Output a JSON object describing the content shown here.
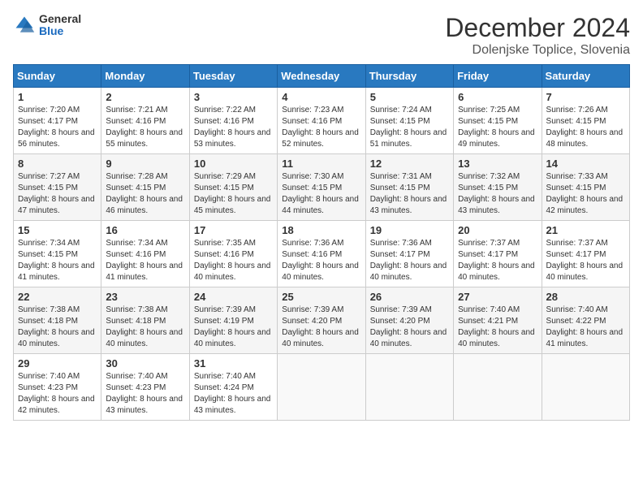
{
  "header": {
    "logo": {
      "general": "General",
      "blue": "Blue"
    },
    "title": "December 2024",
    "location": "Dolenjske Toplice, Slovenia"
  },
  "weekdays": [
    "Sunday",
    "Monday",
    "Tuesday",
    "Wednesday",
    "Thursday",
    "Friday",
    "Saturday"
  ],
  "weeks": [
    [
      {
        "day": "1",
        "sunrise": "7:20 AM",
        "sunset": "4:17 PM",
        "daylight": "8 hours and 56 minutes."
      },
      {
        "day": "2",
        "sunrise": "7:21 AM",
        "sunset": "4:16 PM",
        "daylight": "8 hours and 55 minutes."
      },
      {
        "day": "3",
        "sunrise": "7:22 AM",
        "sunset": "4:16 PM",
        "daylight": "8 hours and 53 minutes."
      },
      {
        "day": "4",
        "sunrise": "7:23 AM",
        "sunset": "4:16 PM",
        "daylight": "8 hours and 52 minutes."
      },
      {
        "day": "5",
        "sunrise": "7:24 AM",
        "sunset": "4:15 PM",
        "daylight": "8 hours and 51 minutes."
      },
      {
        "day": "6",
        "sunrise": "7:25 AM",
        "sunset": "4:15 PM",
        "daylight": "8 hours and 49 minutes."
      },
      {
        "day": "7",
        "sunrise": "7:26 AM",
        "sunset": "4:15 PM",
        "daylight": "8 hours and 48 minutes."
      }
    ],
    [
      {
        "day": "8",
        "sunrise": "7:27 AM",
        "sunset": "4:15 PM",
        "daylight": "8 hours and 47 minutes."
      },
      {
        "day": "9",
        "sunrise": "7:28 AM",
        "sunset": "4:15 PM",
        "daylight": "8 hours and 46 minutes."
      },
      {
        "day": "10",
        "sunrise": "7:29 AM",
        "sunset": "4:15 PM",
        "daylight": "8 hours and 45 minutes."
      },
      {
        "day": "11",
        "sunrise": "7:30 AM",
        "sunset": "4:15 PM",
        "daylight": "8 hours and 44 minutes."
      },
      {
        "day": "12",
        "sunrise": "7:31 AM",
        "sunset": "4:15 PM",
        "daylight": "8 hours and 43 minutes."
      },
      {
        "day": "13",
        "sunrise": "7:32 AM",
        "sunset": "4:15 PM",
        "daylight": "8 hours and 43 minutes."
      },
      {
        "day": "14",
        "sunrise": "7:33 AM",
        "sunset": "4:15 PM",
        "daylight": "8 hours and 42 minutes."
      }
    ],
    [
      {
        "day": "15",
        "sunrise": "7:34 AM",
        "sunset": "4:15 PM",
        "daylight": "8 hours and 41 minutes."
      },
      {
        "day": "16",
        "sunrise": "7:34 AM",
        "sunset": "4:16 PM",
        "daylight": "8 hours and 41 minutes."
      },
      {
        "day": "17",
        "sunrise": "7:35 AM",
        "sunset": "4:16 PM",
        "daylight": "8 hours and 40 minutes."
      },
      {
        "day": "18",
        "sunrise": "7:36 AM",
        "sunset": "4:16 PM",
        "daylight": "8 hours and 40 minutes."
      },
      {
        "day": "19",
        "sunrise": "7:36 AM",
        "sunset": "4:17 PM",
        "daylight": "8 hours and 40 minutes."
      },
      {
        "day": "20",
        "sunrise": "7:37 AM",
        "sunset": "4:17 PM",
        "daylight": "8 hours and 40 minutes."
      },
      {
        "day": "21",
        "sunrise": "7:37 AM",
        "sunset": "4:17 PM",
        "daylight": "8 hours and 40 minutes."
      }
    ],
    [
      {
        "day": "22",
        "sunrise": "7:38 AM",
        "sunset": "4:18 PM",
        "daylight": "8 hours and 40 minutes."
      },
      {
        "day": "23",
        "sunrise": "7:38 AM",
        "sunset": "4:18 PM",
        "daylight": "8 hours and 40 minutes."
      },
      {
        "day": "24",
        "sunrise": "7:39 AM",
        "sunset": "4:19 PM",
        "daylight": "8 hours and 40 minutes."
      },
      {
        "day": "25",
        "sunrise": "7:39 AM",
        "sunset": "4:20 PM",
        "daylight": "8 hours and 40 minutes."
      },
      {
        "day": "26",
        "sunrise": "7:39 AM",
        "sunset": "4:20 PM",
        "daylight": "8 hours and 40 minutes."
      },
      {
        "day": "27",
        "sunrise": "7:40 AM",
        "sunset": "4:21 PM",
        "daylight": "8 hours and 40 minutes."
      },
      {
        "day": "28",
        "sunrise": "7:40 AM",
        "sunset": "4:22 PM",
        "daylight": "8 hours and 41 minutes."
      }
    ],
    [
      {
        "day": "29",
        "sunrise": "7:40 AM",
        "sunset": "4:23 PM",
        "daylight": "8 hours and 42 minutes."
      },
      {
        "day": "30",
        "sunrise": "7:40 AM",
        "sunset": "4:23 PM",
        "daylight": "8 hours and 43 minutes."
      },
      {
        "day": "31",
        "sunrise": "7:40 AM",
        "sunset": "4:24 PM",
        "daylight": "8 hours and 43 minutes."
      },
      null,
      null,
      null,
      null
    ]
  ]
}
